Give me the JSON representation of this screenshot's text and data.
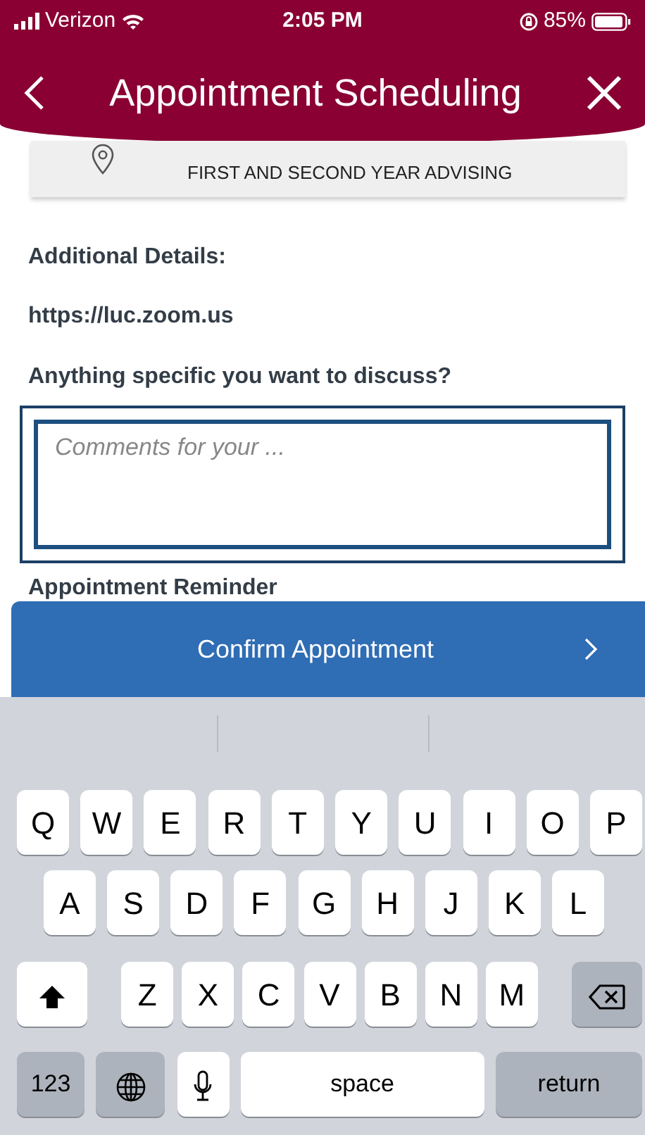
{
  "status_bar": {
    "carrier": "Verizon",
    "time": "2:05 PM",
    "battery": "85%"
  },
  "header": {
    "title": "Appointment Scheduling"
  },
  "location": {
    "name": "FIRST AND SECOND YEAR ADVISING"
  },
  "additional_details": {
    "label": "Additional Details:",
    "value": "https://luc.zoom.us"
  },
  "question": {
    "label": "Anything specific you want to discuss?",
    "placeholder": "Comments for your ..."
  },
  "reminder_label": "Appointment Reminder",
  "confirm_button": {
    "label": "Confirm Appointment"
  },
  "keyboard": {
    "key_rows": [
      {
        "keys": [
          {
            "kind": "letter",
            "label": "Q"
          },
          {
            "kind": "letter",
            "label": "W"
          },
          {
            "kind": "letter",
            "label": "E"
          },
          {
            "kind": "letter",
            "label": "R"
          },
          {
            "kind": "letter",
            "label": "T"
          },
          {
            "kind": "letter",
            "label": "Y"
          },
          {
            "kind": "letter",
            "label": "U"
          },
          {
            "kind": "letter",
            "label": "I"
          },
          {
            "kind": "letter",
            "label": "O"
          },
          {
            "kind": "letter",
            "label": "P"
          }
        ]
      },
      {
        "keys": [
          {
            "kind": "letter",
            "label": "A"
          },
          {
            "kind": "letter",
            "label": "S"
          },
          {
            "kind": "letter",
            "label": "D"
          },
          {
            "kind": "letter",
            "label": "F"
          },
          {
            "kind": "letter",
            "label": "G"
          },
          {
            "kind": "letter",
            "label": "H"
          },
          {
            "kind": "letter",
            "label": "J"
          },
          {
            "kind": "letter",
            "label": "K"
          },
          {
            "kind": "letter",
            "label": "L"
          }
        ]
      },
      {
        "keys": [
          {
            "kind": "shift"
          },
          {
            "kind": "letter",
            "label": "Z"
          },
          {
            "kind": "letter",
            "label": "X"
          },
          {
            "kind": "letter",
            "label": "C"
          },
          {
            "kind": "letter",
            "label": "V"
          },
          {
            "kind": "letter",
            "label": "B"
          },
          {
            "kind": "letter",
            "label": "N"
          },
          {
            "kind": "letter",
            "label": "M"
          },
          {
            "kind": "backspace"
          }
        ]
      },
      {
        "keys": [
          {
            "kind": "mode",
            "label": "123"
          },
          {
            "kind": "globe"
          },
          {
            "kind": "mic"
          },
          {
            "kind": "space",
            "label": "space"
          },
          {
            "kind": "return",
            "label": "return"
          }
        ]
      }
    ]
  }
}
